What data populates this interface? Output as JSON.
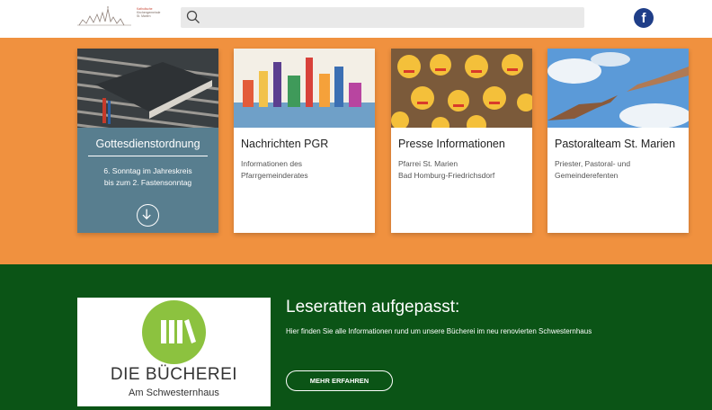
{
  "header": {
    "logo_lines": [
      "Katholische",
      "Kirchengemeinde",
      "St. Marien"
    ],
    "search_placeholder": "",
    "facebook_glyph": "f"
  },
  "cards": [
    {
      "title": "Gottesdienstordnung",
      "text_lines": [
        "6. Sonntag im Jahreskreis",
        "bis zum 2. Fastensonntag"
      ],
      "icon": "arrow-down-circle-icon",
      "color": "#587e8f",
      "image": "hymnbook-on-pews"
    },
    {
      "title": "Nachrichten PGR",
      "text_lines": [
        "Informationen des",
        "Pfarrgemeinderates"
      ],
      "image": "painted-skyline"
    },
    {
      "title": "Presse Informationen",
      "text_lines": [
        "Pfarrei St. Marien",
        "Bad Homburg-Friedrichsdorf"
      ],
      "image": "painted-faces"
    },
    {
      "title": "Pastoralteam St. Marien",
      "text_lines": [
        "Priester, Pastoral- und",
        "Gemeinderefenten"
      ],
      "image": "reaching-hands"
    }
  ],
  "promo": {
    "library_name": "DIE BÜCHEREI",
    "library_sub": "Am Schwesternhaus",
    "headline": "Leseratten aufgepasst:",
    "paragraph": "Hier finden Sie alle Informationen rund um unsere Bücherei im neu renovierten Schwesternhaus",
    "button": "MEHR ERFAHREN"
  },
  "colors": {
    "orange": "#f0913f",
    "green": "#0b5416",
    "card_blue": "#587e8f",
    "library_green": "#8cc23f",
    "facebook": "#1f3e88"
  }
}
